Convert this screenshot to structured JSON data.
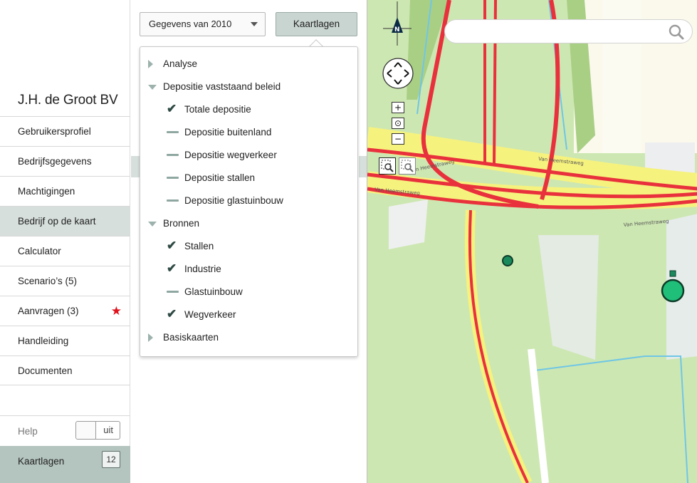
{
  "sidebar": {
    "company": "J.H. de Groot BV",
    "items": [
      {
        "label": "Gebruikersprofiel"
      },
      {
        "label": "Bedrijfsgegevens"
      },
      {
        "label": "Machtigingen"
      },
      {
        "label": "Bedrijf op de kaart",
        "active": true
      },
      {
        "label": "Calculator"
      },
      {
        "label": "Scenario’s (5)"
      },
      {
        "label": "Aanvragen (3)",
        "icon": "star-icon"
      },
      {
        "label": "Handleiding"
      },
      {
        "label": "Documenten"
      }
    ],
    "help_label": "Help",
    "help_toggle": "uit",
    "kaartlagen_label": "Kaartlagen",
    "kaartlagen_count": "12"
  },
  "panel": {
    "year_select": "Gegevens van 2010",
    "layers_button": "Kaartlagen",
    "tree": [
      {
        "label": "Analyse",
        "type": "group",
        "expanded": false
      },
      {
        "label": "Depositie vaststaand beleid",
        "type": "group",
        "expanded": true
      },
      {
        "label": "Totale depositie",
        "type": "item",
        "checked": true
      },
      {
        "label": "Depositie buitenland",
        "type": "item",
        "checked": false
      },
      {
        "label": "Depositie wegverkeer",
        "type": "item",
        "checked": false
      },
      {
        "label": "Depositie stallen",
        "type": "item",
        "checked": false
      },
      {
        "label": "Depositie glastuinbouw",
        "type": "item",
        "checked": false
      },
      {
        "label": "Bronnen",
        "type": "group",
        "expanded": true
      },
      {
        "label": "Stallen",
        "type": "item",
        "checked": true
      },
      {
        "label": "Industrie",
        "type": "item",
        "checked": true
      },
      {
        "label": "Glastuinbouw",
        "type": "item",
        "checked": false
      },
      {
        "label": "Wegverkeer",
        "type": "item",
        "checked": true
      },
      {
        "label": "Basiskaarten",
        "type": "group",
        "expanded": false
      }
    ]
  },
  "map": {
    "compass_label": "N",
    "road_labels": [
      "Van Heemstraweg",
      "Van Heemstraweg",
      "Van Heemstraweg",
      "Van Heemstraweg"
    ],
    "colors": {
      "road": "#e8313c",
      "highway": "#f6f27e",
      "grass": "#cde7b2",
      "water": "#6fc6e6",
      "marker": "#1fbf7a"
    }
  },
  "icons": [
    "search-icon",
    "compass-icon",
    "pan-icon",
    "zoom-in-icon",
    "zoom-reset-icon",
    "zoom-out-icon",
    "zoom-box-icon",
    "zoom-box-out-icon",
    "star-icon",
    "checkmark-icon",
    "expand-triangle-icon"
  ]
}
